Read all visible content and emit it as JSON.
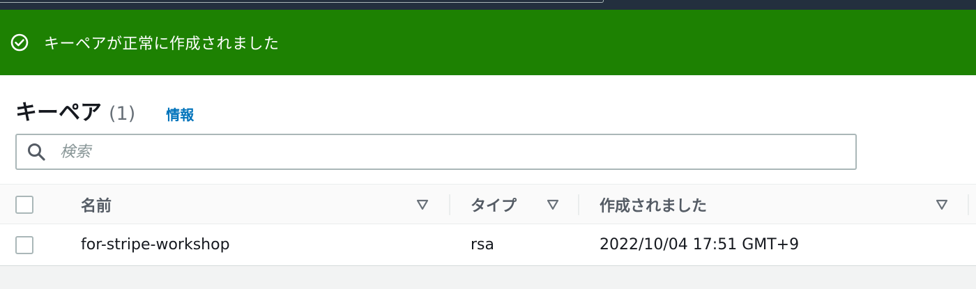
{
  "flash": {
    "message": "キーペアが正常に作成されました",
    "icon": "check-circle-icon",
    "color": "#1d8102"
  },
  "header": {
    "title": "キーペア",
    "count": "(1)",
    "info_link": "情報"
  },
  "search": {
    "placeholder": "検索",
    "value": ""
  },
  "table": {
    "columns": [
      {
        "label": "名前"
      },
      {
        "label": "タイプ"
      },
      {
        "label": "作成されました"
      }
    ],
    "rows": [
      {
        "name": "for-stripe-workshop",
        "type": "rsa",
        "created": "2022/10/04 17:51 GMT+9"
      }
    ]
  }
}
